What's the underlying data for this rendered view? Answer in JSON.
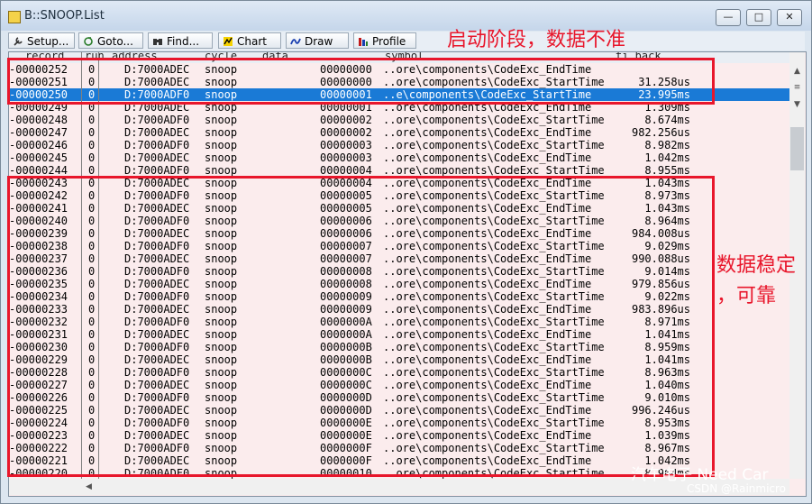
{
  "window": {
    "title": "B::SNOOP.List",
    "min_glyph": "—",
    "max_glyph": "□",
    "close_glyph": "✕"
  },
  "toolbar": {
    "setup": "Setup...",
    "goto": "Goto...",
    "find": "Find...",
    "chart": "Chart",
    "draw": "Draw",
    "profile": "Profile"
  },
  "columns": {
    "record": "record",
    "run": "run",
    "address": "address",
    "cycle": "cycle",
    "data": "data",
    "symbol": "symbol",
    "ti_back": "ti.back"
  },
  "rows": [
    {
      "record": "-00000252",
      "run": "0",
      "address": "D:7000ADEC",
      "cycle": "snoop",
      "data": "00000000",
      "symbol": "..ore\\components\\CodeExc_EndTime",
      "ti_back": ""
    },
    {
      "record": "-00000251",
      "run": "0",
      "address": "D:7000ADEC",
      "cycle": "snoop",
      "data": "00000000",
      "symbol": "..ore\\components\\CodeExc_StartTime",
      "ti_back": "31.258us"
    },
    {
      "record": "-00000250",
      "run": "0",
      "address": "D:7000ADF0",
      "cycle": "snoop",
      "data": "00000001",
      "symbol": "..e\\components\\CodeExc_StartTime",
      "ti_back": "23.995ms",
      "selected": true
    },
    {
      "record": "-00000249",
      "run": "0",
      "address": "D:7000ADEC",
      "cycle": "snoop",
      "data": "00000001",
      "symbol": "..ore\\components\\CodeExc_EndTime",
      "ti_back": "1.309ms"
    },
    {
      "record": "-00000248",
      "run": "0",
      "address": "D:7000ADF0",
      "cycle": "snoop",
      "data": "00000002",
      "symbol": "..ore\\components\\CodeExc_StartTime",
      "ti_back": "8.674ms"
    },
    {
      "record": "-00000247",
      "run": "0",
      "address": "D:7000ADEC",
      "cycle": "snoop",
      "data": "00000002",
      "symbol": "..ore\\components\\CodeExc_EndTime",
      "ti_back": "982.256us"
    },
    {
      "record": "-00000246",
      "run": "0",
      "address": "D:7000ADF0",
      "cycle": "snoop",
      "data": "00000003",
      "symbol": "..ore\\components\\CodeExc_StartTime",
      "ti_back": "8.982ms"
    },
    {
      "record": "-00000245",
      "run": "0",
      "address": "D:7000ADEC",
      "cycle": "snoop",
      "data": "00000003",
      "symbol": "..ore\\components\\CodeExc_EndTime",
      "ti_back": "1.042ms"
    },
    {
      "record": "-00000244",
      "run": "0",
      "address": "D:7000ADF0",
      "cycle": "snoop",
      "data": "00000004",
      "symbol": "..ore\\components\\CodeExc_StartTime",
      "ti_back": "8.955ms"
    },
    {
      "record": "-00000243",
      "run": "0",
      "address": "D:7000ADEC",
      "cycle": "snoop",
      "data": "00000004",
      "symbol": "..ore\\components\\CodeExc_EndTime",
      "ti_back": "1.043ms"
    },
    {
      "record": "-00000242",
      "run": "0",
      "address": "D:7000ADF0",
      "cycle": "snoop",
      "data": "00000005",
      "symbol": "..ore\\components\\CodeExc_StartTime",
      "ti_back": "8.973ms"
    },
    {
      "record": "-00000241",
      "run": "0",
      "address": "D:7000ADEC",
      "cycle": "snoop",
      "data": "00000005",
      "symbol": "..ore\\components\\CodeExc_EndTime",
      "ti_back": "1.043ms"
    },
    {
      "record": "-00000240",
      "run": "0",
      "address": "D:7000ADF0",
      "cycle": "snoop",
      "data": "00000006",
      "symbol": "..ore\\components\\CodeExc_StartTime",
      "ti_back": "8.964ms"
    },
    {
      "record": "-00000239",
      "run": "0",
      "address": "D:7000ADEC",
      "cycle": "snoop",
      "data": "00000006",
      "symbol": "..ore\\components\\CodeExc_EndTime",
      "ti_back": "984.008us"
    },
    {
      "record": "-00000238",
      "run": "0",
      "address": "D:7000ADF0",
      "cycle": "snoop",
      "data": "00000007",
      "symbol": "..ore\\components\\CodeExc_StartTime",
      "ti_back": "9.029ms"
    },
    {
      "record": "-00000237",
      "run": "0",
      "address": "D:7000ADEC",
      "cycle": "snoop",
      "data": "00000007",
      "symbol": "..ore\\components\\CodeExc_EndTime",
      "ti_back": "990.088us"
    },
    {
      "record": "-00000236",
      "run": "0",
      "address": "D:7000ADF0",
      "cycle": "snoop",
      "data": "00000008",
      "symbol": "..ore\\components\\CodeExc_StartTime",
      "ti_back": "9.014ms"
    },
    {
      "record": "-00000235",
      "run": "0",
      "address": "D:7000ADEC",
      "cycle": "snoop",
      "data": "00000008",
      "symbol": "..ore\\components\\CodeExc_EndTime",
      "ti_back": "979.856us"
    },
    {
      "record": "-00000234",
      "run": "0",
      "address": "D:7000ADF0",
      "cycle": "snoop",
      "data": "00000009",
      "symbol": "..ore\\components\\CodeExc_StartTime",
      "ti_back": "9.022ms"
    },
    {
      "record": "-00000233",
      "run": "0",
      "address": "D:7000ADEC",
      "cycle": "snoop",
      "data": "00000009",
      "symbol": "..ore\\components\\CodeExc_EndTime",
      "ti_back": "983.896us"
    },
    {
      "record": "-00000232",
      "run": "0",
      "address": "D:7000ADF0",
      "cycle": "snoop",
      "data": "0000000A",
      "symbol": "..ore\\components\\CodeExc_StartTime",
      "ti_back": "8.971ms"
    },
    {
      "record": "-00000231",
      "run": "0",
      "address": "D:7000ADEC",
      "cycle": "snoop",
      "data": "0000000A",
      "symbol": "..ore\\components\\CodeExc_EndTime",
      "ti_back": "1.041ms"
    },
    {
      "record": "-00000230",
      "run": "0",
      "address": "D:7000ADF0",
      "cycle": "snoop",
      "data": "0000000B",
      "symbol": "..ore\\components\\CodeExc_StartTime",
      "ti_back": "8.959ms"
    },
    {
      "record": "-00000229",
      "run": "0",
      "address": "D:7000ADEC",
      "cycle": "snoop",
      "data": "0000000B",
      "symbol": "..ore\\components\\CodeExc_EndTime",
      "ti_back": "1.041ms"
    },
    {
      "record": "-00000228",
      "run": "0",
      "address": "D:7000ADF0",
      "cycle": "snoop",
      "data": "0000000C",
      "symbol": "..ore\\components\\CodeExc_StartTime",
      "ti_back": "8.963ms"
    },
    {
      "record": "-00000227",
      "run": "0",
      "address": "D:7000ADEC",
      "cycle": "snoop",
      "data": "0000000C",
      "symbol": "..ore\\components\\CodeExc_EndTime",
      "ti_back": "1.040ms"
    },
    {
      "record": "-00000226",
      "run": "0",
      "address": "D:7000ADF0",
      "cycle": "snoop",
      "data": "0000000D",
      "symbol": "..ore\\components\\CodeExc_StartTime",
      "ti_back": "9.010ms"
    },
    {
      "record": "-00000225",
      "run": "0",
      "address": "D:7000ADEC",
      "cycle": "snoop",
      "data": "0000000D",
      "symbol": "..ore\\components\\CodeExc_EndTime",
      "ti_back": "996.246us"
    },
    {
      "record": "-00000224",
      "run": "0",
      "address": "D:7000ADF0",
      "cycle": "snoop",
      "data": "0000000E",
      "symbol": "..ore\\components\\CodeExc_StartTime",
      "ti_back": "8.953ms"
    },
    {
      "record": "-00000223",
      "run": "0",
      "address": "D:7000ADEC",
      "cycle": "snoop",
      "data": "0000000E",
      "symbol": "..ore\\components\\CodeExc_EndTime",
      "ti_back": "1.039ms"
    },
    {
      "record": "-00000222",
      "run": "0",
      "address": "D:7000ADF0",
      "cycle": "snoop",
      "data": "0000000F",
      "symbol": "..ore\\components\\CodeExc_StartTime",
      "ti_back": "8.967ms"
    },
    {
      "record": "-00000221",
      "run": "0",
      "address": "D:7000ADEC",
      "cycle": "snoop",
      "data": "0000000F",
      "symbol": "..ore\\components\\CodeExc_EndTime",
      "ti_back": "1.042ms"
    },
    {
      "record": "-00000220",
      "run": "0",
      "address": "D:7000ADF0",
      "cycle": "snoop",
      "data": "00000010",
      "symbol": "..ore\\components\\CodeExc_StartTime",
      "ti_back": "8.964ms"
    }
  ],
  "annotations": {
    "startup": "启动阶段，数据不准",
    "stable_line1": "数据稳定",
    "stable_line2": "，可靠"
  },
  "watermarks": {
    "wechat": "汽车电子 Need Car",
    "csdn": "CSDN @Rainmicro"
  },
  "colors": {
    "selected_row": "#1a7ad6",
    "list_background": "#fbeced",
    "annotation_red": "#e8162b"
  }
}
